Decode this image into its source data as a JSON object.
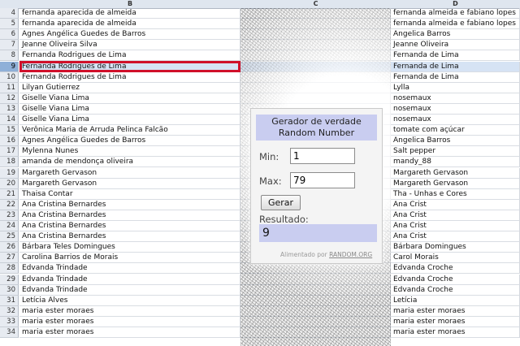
{
  "columns": [
    "B",
    "C",
    "D"
  ],
  "rows": [
    {
      "num": "4",
      "b": "fernanda aparecida de almeida",
      "d": "fernanda almeida e fabiano lopes"
    },
    {
      "num": "5",
      "b": "fernanda aparecida de almeida",
      "d": "fernanda almeida e fabiano lopes"
    },
    {
      "num": "6",
      "b": "Agnes Angélica Guedes de Barros",
      "d": "Angelica Barros"
    },
    {
      "num": "7",
      "b": "Jeanne Oliveira Silva",
      "d": "Jeanne Oliveira"
    },
    {
      "num": "8",
      "b": "Fernanda Rodrigues de Lima",
      "d": "Fernanda de Lima"
    },
    {
      "num": "9",
      "b": "Fernanda Rodrigues de Lima",
      "d": "Fernanda de Lima"
    },
    {
      "num": "10",
      "b": "Fernanda Rodrigues de Lima",
      "d": "Fernanda de Lima"
    },
    {
      "num": "11",
      "b": "Lilyan Gutierrez",
      "d": "Lylla"
    },
    {
      "num": "12",
      "b": "Giselle Viana Lima",
      "d": "nosemaux"
    },
    {
      "num": "13",
      "b": "Giselle Viana Lima",
      "d": "nosemaux"
    },
    {
      "num": "14",
      "b": "Giselle Viana Lima",
      "d": "nosemaux"
    },
    {
      "num": "15",
      "b": "Verônica Maria de Arruda Pelinca Falcão",
      "d": "tomate com açúcar"
    },
    {
      "num": "16",
      "b": "Agnes Angélica Guedes de Barros",
      "d": "Angelica Barros"
    },
    {
      "num": "17",
      "b": "Mylenna Nunes",
      "d": "Salt pepper"
    },
    {
      "num": "18",
      "b": "amanda de mendonça oliveira",
      "d": "mandy_88"
    },
    {
      "num": "19",
      "b": "Margareth Gervason",
      "d": "Margareth Gervason"
    },
    {
      "num": "20",
      "b": "Margareth Gervason",
      "d": "Margareth Gervason"
    },
    {
      "num": "21",
      "b": "Thaisa Contar",
      "d": "Tha - Unhas e Cores"
    },
    {
      "num": "22",
      "b": "Ana Cristina Bernardes",
      "d": "Ana Crist"
    },
    {
      "num": "23",
      "b": "Ana Cristina Bernardes",
      "d": "Ana Crist"
    },
    {
      "num": "24",
      "b": "Ana Cristina Bernardes",
      "d": "Ana Crist"
    },
    {
      "num": "25",
      "b": "Ana Cristina Bernardes",
      "d": "Ana Crist"
    },
    {
      "num": "26",
      "b": "Bárbara Teles Domingues",
      "d": "Bárbara Domingues"
    },
    {
      "num": "27",
      "b": "Carolina Barrios de Morais",
      "d": "Carol Morais"
    },
    {
      "num": "28",
      "b": "Edvanda Trindade",
      "d": "Edvanda Croche"
    },
    {
      "num": "29",
      "b": "Edvanda Trindade",
      "d": "Edvanda Croche"
    },
    {
      "num": "30",
      "b": "Edvanda Trindade",
      "d": "Edvanda Croche"
    },
    {
      "num": "31",
      "b": "Letícia Alves",
      "d": "Letícia"
    },
    {
      "num": "32",
      "b": "maria ester moraes",
      "d": "maria ester moraes"
    },
    {
      "num": "33",
      "b": "maria ester moraes",
      "d": "maria ester moraes"
    },
    {
      "num": "34",
      "b": "maria ester moraes",
      "d": "maria ester moraes"
    }
  ],
  "selected_row": "9",
  "widget": {
    "title_line1": "Gerador de verdade",
    "title_line2": "Random Number",
    "min_label": "Min:",
    "min_value": "1",
    "max_label": "Max:",
    "max_value": "79",
    "button_label": "Gerar",
    "result_label": "Resultado:",
    "result_value": "9",
    "powered_text": "Alimentado por",
    "powered_link": "RANDOM.ORG",
    "accent_color": "#c9cdf0"
  },
  "colors": {
    "selection_border": "#d0102a",
    "selection_fill": "#d6e3f4",
    "header_bg": "#dfe6ef"
  }
}
